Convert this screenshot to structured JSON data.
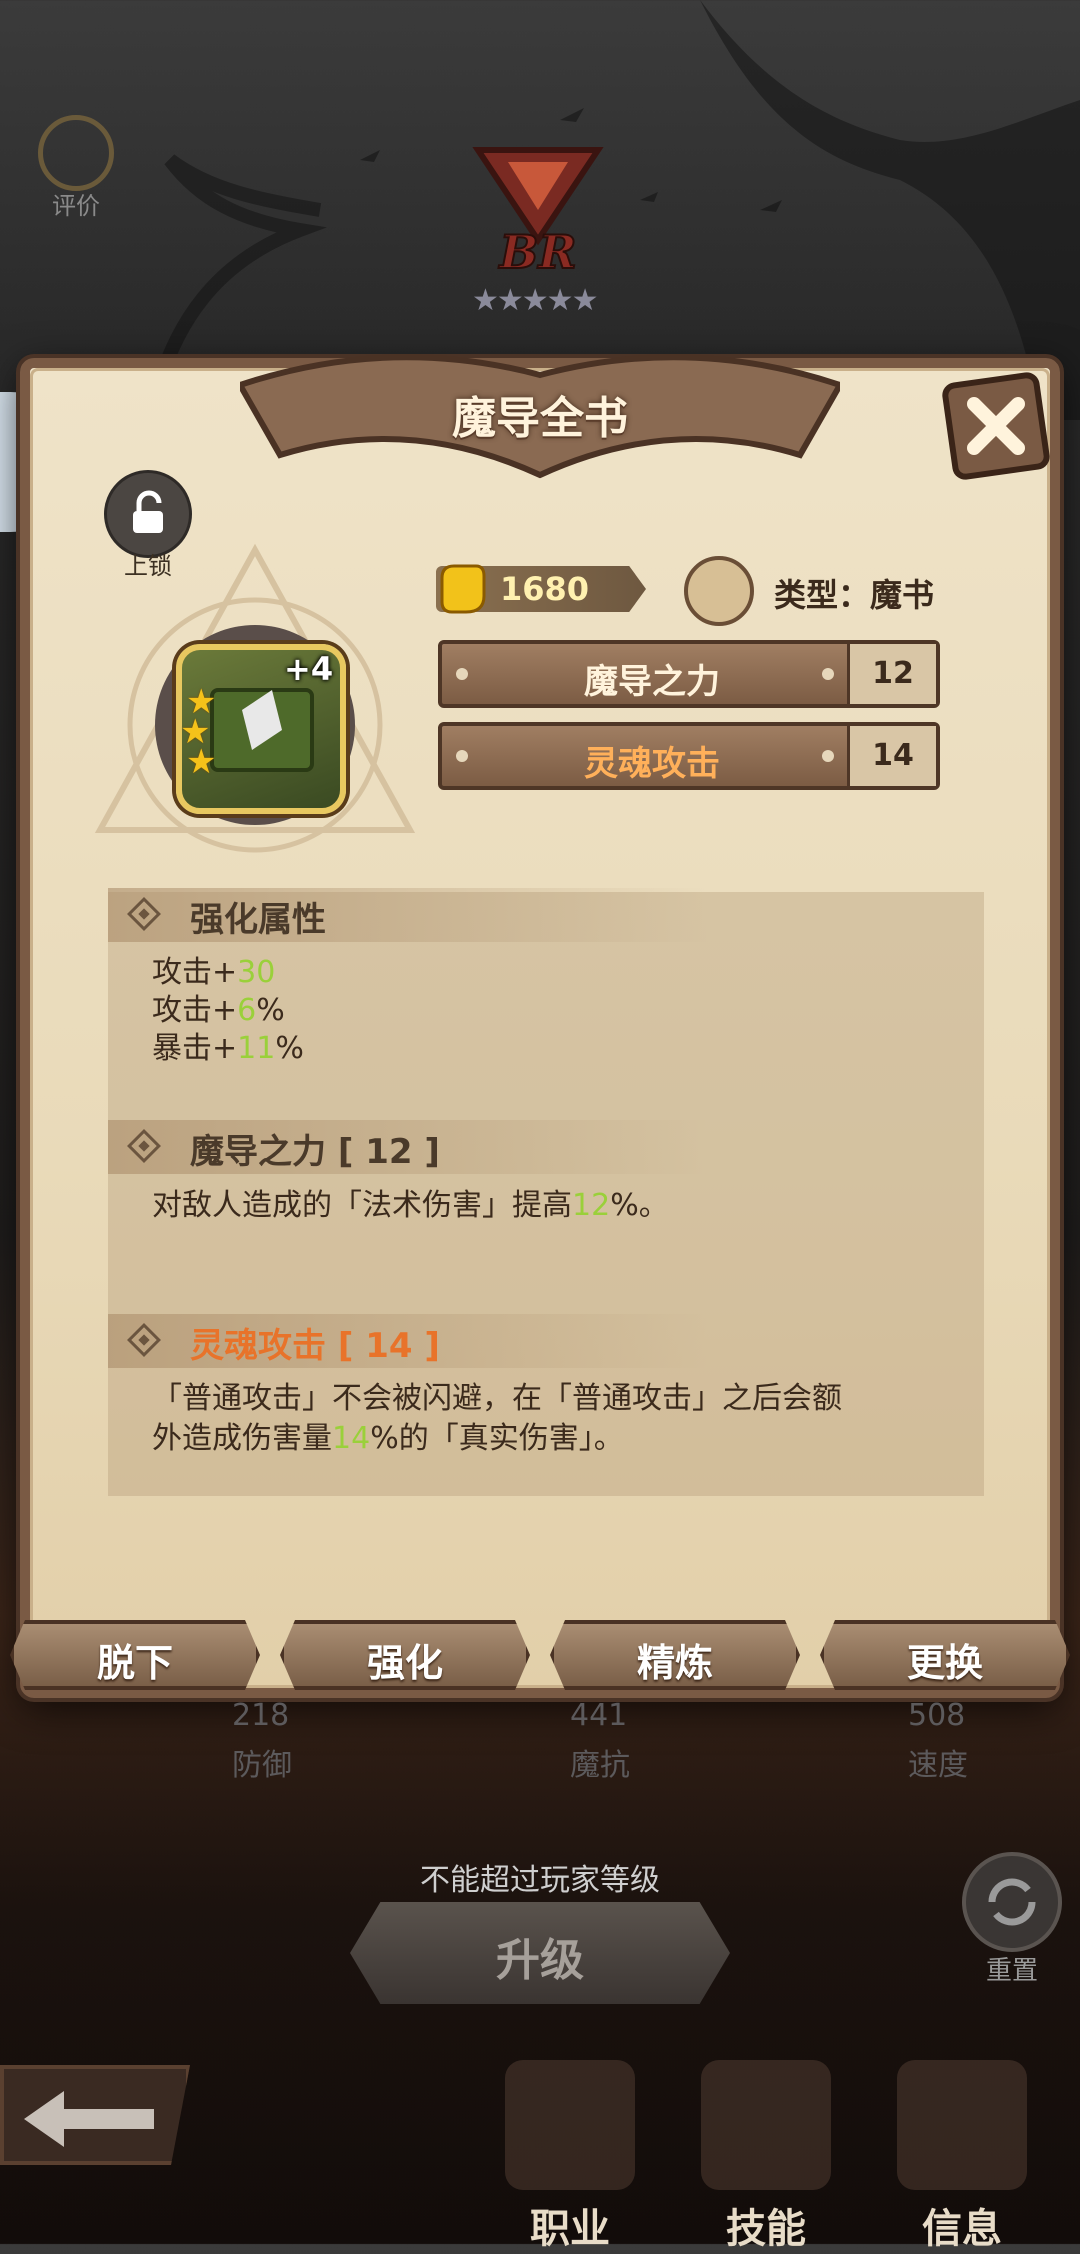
{
  "top": {
    "rate_label": "评价",
    "rank_text": "BR",
    "stars": "★★★★★"
  },
  "panel": {
    "title": "魔导全书",
    "lock_label": "上锁",
    "item_plus": "+4",
    "price": "1680",
    "type_label": "类型：魔书",
    "skills": [
      {
        "name": "魔导之力",
        "level": "12",
        "color": "#fff3dc"
      },
      {
        "name": "灵魂攻击",
        "level": "14",
        "color": "#ffb05a"
      }
    ],
    "enhance": {
      "title": "强化属性",
      "lines": [
        {
          "label": "攻击+",
          "value": "30",
          "suffix": ""
        },
        {
          "label": "攻击+",
          "value": "6",
          "suffix": "%"
        },
        {
          "label": "暴击+",
          "value": "11",
          "suffix": "%"
        }
      ]
    },
    "skill1": {
      "title": "魔导之力 [ 12 ]",
      "pre": "对敌人造成的「法术伤害」提高",
      "value": "12",
      "post": "%。"
    },
    "skill2": {
      "title": "灵魂攻击 [ 14 ]",
      "line1": "「普通攻击」不会被闪避，在「普通攻击」之后会额",
      "pre": "外造成伤害量",
      "value": "14",
      "post": "%的「真实伤害」。"
    },
    "buttons": [
      "脱下",
      "强化",
      "精炼",
      "更换"
    ]
  },
  "stats_under": [
    {
      "value": "218",
      "label": "防御"
    },
    {
      "value": "441",
      "label": "魔抗"
    },
    {
      "value": "508",
      "label": "速度"
    }
  ],
  "upgrade": {
    "note": "不能超过玩家等级",
    "label": "升级"
  },
  "reset_label": "重置",
  "nav": [
    "职业",
    "技能",
    "信息"
  ],
  "colors": {
    "highlight": "#9ad03a",
    "accent_orange": "#e8732a"
  }
}
